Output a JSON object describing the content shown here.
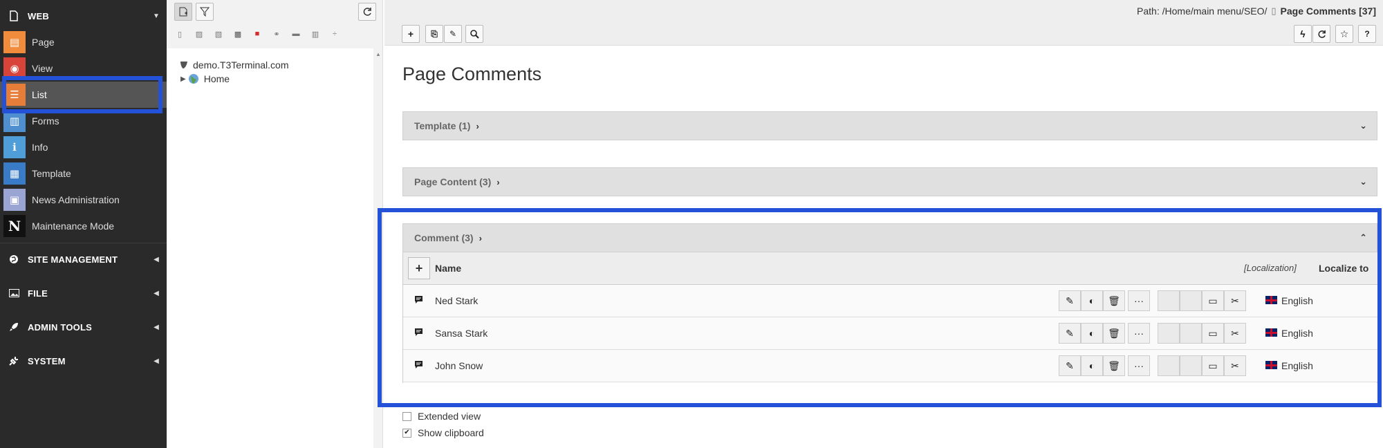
{
  "sidebar": {
    "web": {
      "label": "WEB",
      "icon": "file-icon"
    },
    "modules": [
      {
        "label": "Page",
        "icon": "page-icon",
        "color": "#f08c3c",
        "glyph": "▤"
      },
      {
        "label": "View",
        "icon": "eye-icon",
        "color": "#d9443a",
        "glyph": "◉"
      },
      {
        "label": "List",
        "icon": "list-icon",
        "color": "#e67e3a",
        "glyph": "☰"
      },
      {
        "label": "Forms",
        "icon": "forms-icon",
        "color": "#4f8fcf",
        "glyph": "▥"
      },
      {
        "label": "Info",
        "icon": "info-icon",
        "color": "#4f9ed8",
        "glyph": "i"
      },
      {
        "label": "Template",
        "icon": "template-icon",
        "color": "#3a7bc8",
        "glyph": "▦"
      },
      {
        "label": "News Administration",
        "icon": "news-icon",
        "color": "#9aa5d4",
        "glyph": "▣"
      },
      {
        "label": "Maintenance Mode",
        "icon": "maintenance-icon",
        "color": "#111111",
        "glyph": "N"
      }
    ],
    "groups": [
      {
        "label": "SITE MANAGEMENT",
        "icon": "globe-icon"
      },
      {
        "label": "FILE",
        "icon": "image-icon"
      },
      {
        "label": "ADMIN TOOLS",
        "icon": "rocket-icon"
      },
      {
        "label": "SYSTEM",
        "icon": "plug-icon"
      }
    ]
  },
  "tree": {
    "root": "demo.T3Terminal.com",
    "child": "Home"
  },
  "docheader": {
    "path_prefix": "Path: /Home/main menu/SEO/",
    "path_page": "Page Comments [37]"
  },
  "main": {
    "title": "Page Comments",
    "panels": [
      {
        "label": "Template (1)"
      },
      {
        "label": "Page Content (3)"
      },
      {
        "label": "Comment (3)"
      }
    ],
    "table": {
      "col_name": "Name",
      "col_localization": "[Localization]",
      "col_localize_to": "Localize to",
      "rows": [
        {
          "name": "Ned Stark",
          "language": "English"
        },
        {
          "name": "Sansa Stark",
          "language": "English"
        },
        {
          "name": "John Snow",
          "language": "English"
        }
      ]
    },
    "options": {
      "extended_view": "Extended view",
      "show_clipboard": "Show clipboard"
    }
  },
  "colors": {
    "highlight": "#2352d9",
    "sidebar_bg": "#2a2a2a"
  }
}
